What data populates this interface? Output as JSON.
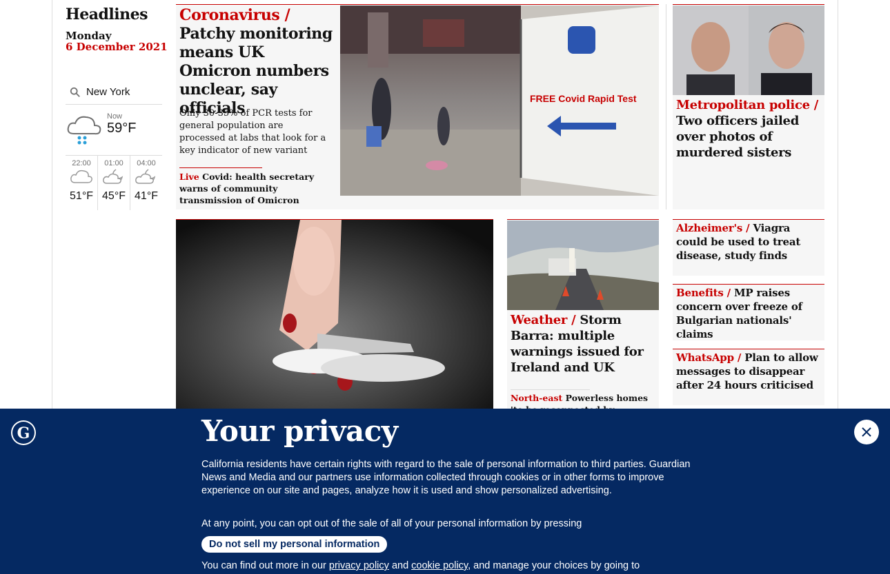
{
  "headlines_label": "Headlines",
  "date": {
    "day": "Monday",
    "full": "6 December 2021"
  },
  "weather": {
    "location": "New York",
    "now": {
      "label": "Now",
      "temp": "59°F",
      "icon": "sleet-cloud-icon"
    },
    "forecast": [
      {
        "time": "22:00",
        "temp": "51°F",
        "icon": "cloud-icon"
      },
      {
        "time": "01:00",
        "temp": "45°F",
        "icon": "moon-cloud-icon"
      },
      {
        "time": "04:00",
        "temp": "41°F",
        "icon": "moon-cloud-icon"
      }
    ]
  },
  "top_story": {
    "kicker": "Coronavirus /",
    "headline": "Patchy monitoring means UK Omicron numbers unclear, say officials",
    "standfirst": "Only 30-35% of PCR tests for general population are processed at labs that look for a key indicator of new variant",
    "sublink_kicker": "Live",
    "sublink": "Covid: health secretary warns of community transmission of Omicron",
    "image_sign_text": "FREE Covid Rapid Test"
  },
  "side_story": {
    "kicker": "Metropolitan police /",
    "headline": "Two officers jailed over photos of murdered sisters"
  },
  "weather_story": {
    "kicker": "Weather /",
    "headline": "Storm Barra: multiple warnings issued for Ireland and UK",
    "sublink_kicker": "North-east",
    "sublink": "Powerless homes 'to be reconnected by Tuesday'"
  },
  "mini_stories": [
    {
      "kicker": "Alzheimer's /",
      "headline": "Viagra could be used to treat disease, study finds"
    },
    {
      "kicker": "Benefits /",
      "headline": "MP raises concern over freeze of Bulgarian nationals' claims"
    },
    {
      "kicker": "WhatsApp /",
      "headline": "Plan to allow messages to disappear after 24 hours criticised"
    }
  ],
  "privacy": {
    "title": "Your privacy",
    "body": "California residents have certain rights with regard to the sale of personal information to third parties. Guardian News and Media and our partners use information collected through cookies or in other forms to improve experience on our site and pages, analyze how it is used and show personalized advertising.",
    "body2": "At any point, you can opt out of the sale of all of your personal information by pressing",
    "button": "Do not sell my personal information",
    "body3_start": "You can find out more in our",
    "privacy_link": "privacy policy",
    "and": "and",
    "cookie_link": "cookie policy",
    "body3_end": ", and manage your choices by going to"
  },
  "colors": {
    "accent": "#c70000",
    "banner": "#052962",
    "card_bg": "#f6f6f6"
  }
}
